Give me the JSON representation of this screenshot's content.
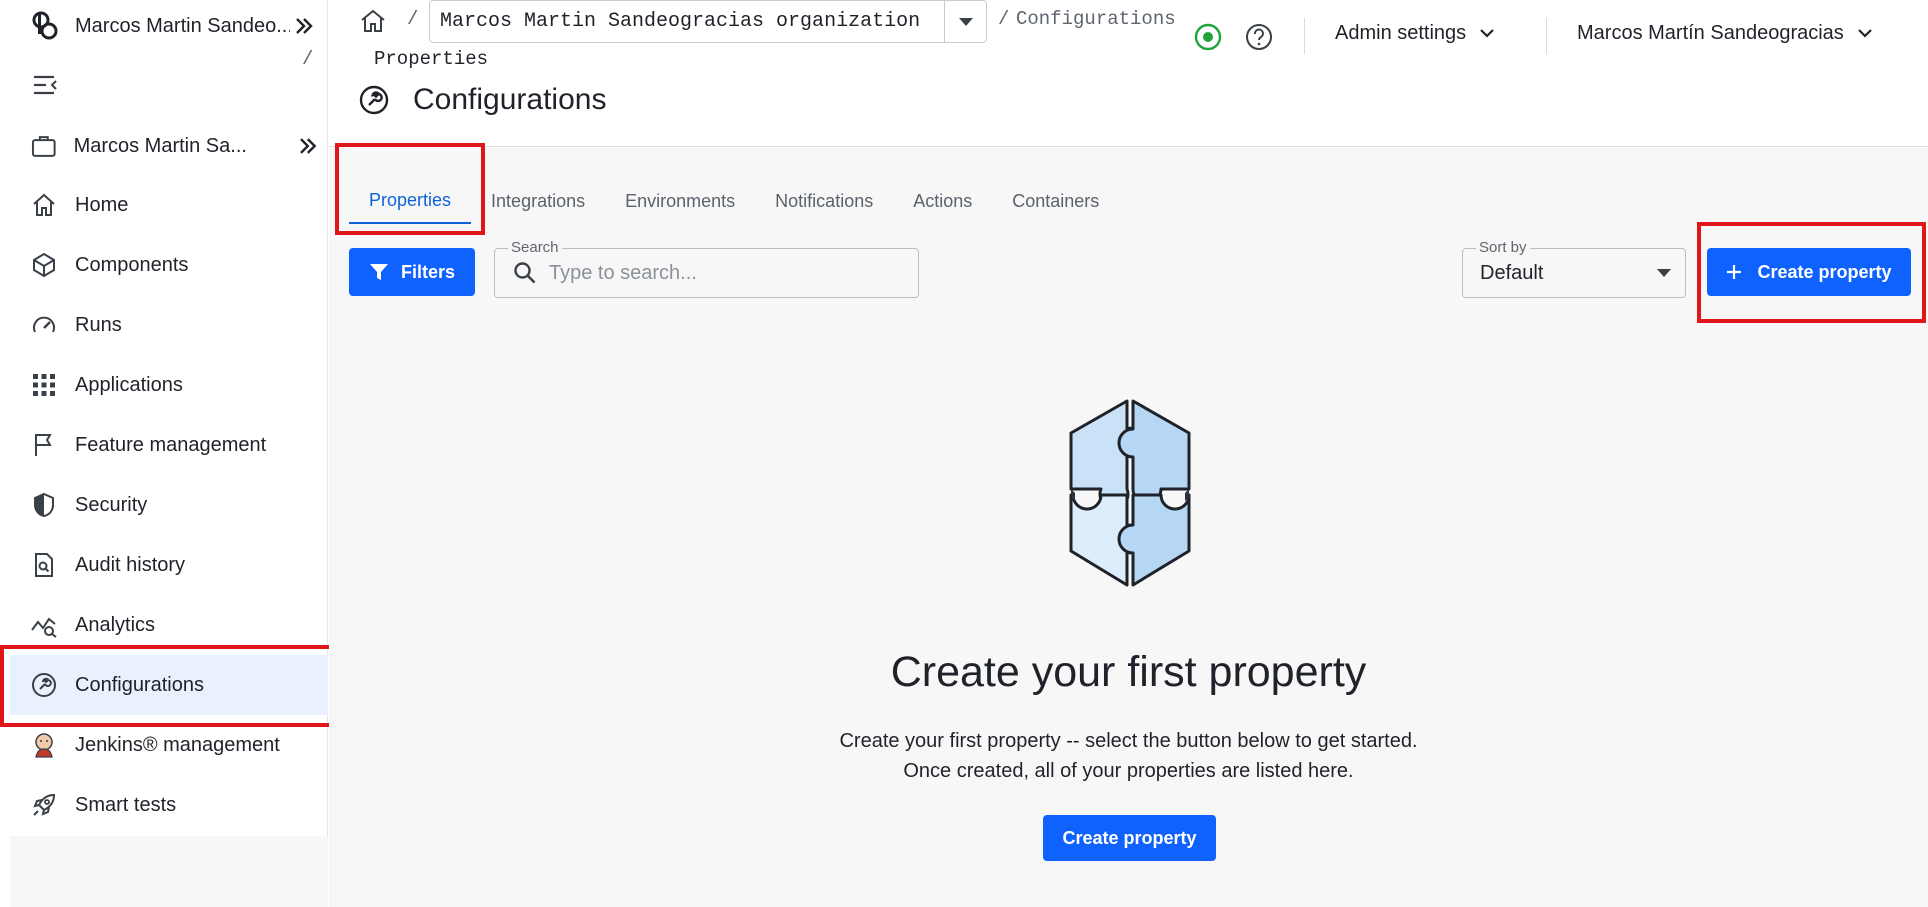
{
  "sidebar": {
    "top_label": "Marcos Martin Sandeo...",
    "org_label": "Marcos Martin Sa...",
    "items": [
      {
        "label": "Home",
        "icon": "home-icon"
      },
      {
        "label": "Components",
        "icon": "cube-icon"
      },
      {
        "label": "Runs",
        "icon": "gauge-icon"
      },
      {
        "label": "Applications",
        "icon": "grid-icon"
      },
      {
        "label": "Feature management",
        "icon": "flag-icon"
      },
      {
        "label": "Security",
        "icon": "shield-icon"
      },
      {
        "label": "Audit history",
        "icon": "document-search-icon"
      },
      {
        "label": "Analytics",
        "icon": "analytics-icon"
      },
      {
        "label": "Configurations",
        "icon": "wrench-icon"
      },
      {
        "label": "Jenkins® management",
        "icon": "jenkins-icon"
      },
      {
        "label": "Smart tests",
        "icon": "rocket-icon"
      }
    ],
    "active_index": 8
  },
  "header": {
    "breadcrumb": {
      "org_value": "Marcos Martin Sandeogracias organization",
      "section": "Configurations",
      "current": "Properties",
      "separator": "/"
    },
    "admin_settings": "Admin settings",
    "user_name": "Marcos Martín Sandeogracias",
    "page_title": "Configurations"
  },
  "tabs": [
    {
      "label": "Properties",
      "active": true
    },
    {
      "label": "Integrations",
      "active": false
    },
    {
      "label": "Environments",
      "active": false
    },
    {
      "label": "Notifications",
      "active": false
    },
    {
      "label": "Actions",
      "active": false
    },
    {
      "label": "Containers",
      "active": false
    }
  ],
  "toolbar": {
    "filters_label": "Filters",
    "search_legend": "Search",
    "search_placeholder": "Type to search...",
    "sort_legend": "Sort by",
    "sort_value": "Default",
    "create_label": "Create property"
  },
  "empty_state": {
    "title": "Create your first property",
    "description": "Create your first property -- select the button below to get started. Once created, all of your properties are listed here.",
    "button_label": "Create property"
  },
  "colors": {
    "primary": "#0f62fe",
    "active_nav_bg": "#e8f1fd",
    "highlight": "#e0161b",
    "status_green": "#1fa33b"
  }
}
